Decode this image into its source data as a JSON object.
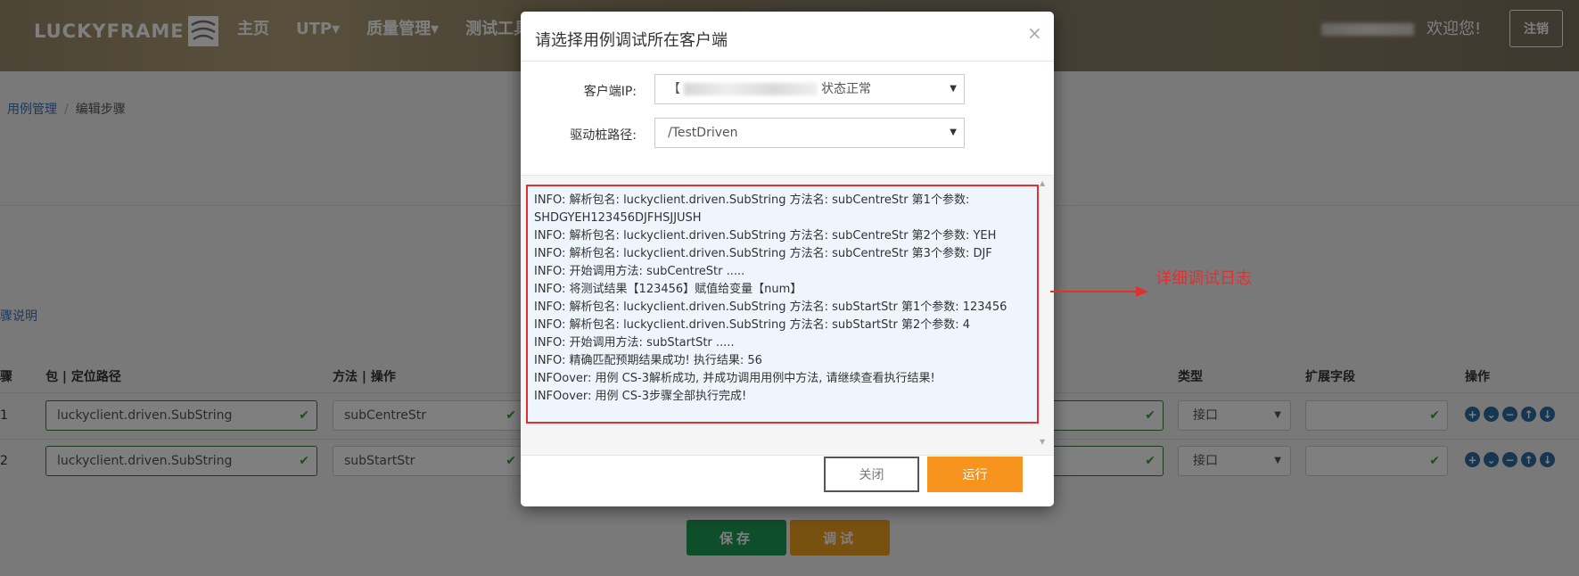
{
  "header": {
    "logo_text": "LUCKYFRAME",
    "nav": [
      "主页",
      "UTP▾",
      "质量管理▾",
      "测试工具"
    ],
    "welcome": "欢迎您!",
    "logout": "注销"
  },
  "breadcrumb": {
    "link": "用例管理",
    "separator": "/",
    "current": "编辑步骤"
  },
  "page": {
    "step_desc_link": "步骤说明",
    "columns": {
      "step": "步骤",
      "package": "包 | 定位路径",
      "method": "方法 | 操作",
      "type": "类型",
      "ext": "扩展字段",
      "ops": "操作"
    },
    "rows": [
      {
        "num": "1",
        "package": "luckyclient.driven.SubString",
        "method": "subCentreStr",
        "type": "接口"
      },
      {
        "num": "2",
        "package": "luckyclient.driven.SubString",
        "method": "subStartStr",
        "type": "接口"
      }
    ],
    "save": "保存",
    "debug": "调试"
  },
  "modal": {
    "title": "请选择用例调试所在客户端",
    "close_x": "×",
    "client_ip_label": "客户端IP:",
    "client_ip_prefix": "【",
    "client_ip_status": "状态正常",
    "driver_path_label": "驱动桩路径:",
    "driver_path_value": "/TestDriven",
    "log_lines": [
      "INFO: 解析包名: luckyclient.driven.SubString 方法名: subCentreStr 第1个参数:",
      "SHDGYEH123456DJFHSJJUSH",
      "INFO: 解析包名: luckyclient.driven.SubString 方法名: subCentreStr 第2个参数: YEH",
      "INFO: 解析包名: luckyclient.driven.SubString 方法名: subCentreStr 第3个参数: DJF",
      "INFO: 开始调用方法: subCentreStr .....",
      "INFO: 将测试结果【123456】赋值给变量【num】",
      "INFO: 解析包名: luckyclient.driven.SubString 方法名: subStartStr 第1个参数: 123456",
      "INFO: 解析包名: luckyclient.driven.SubString 方法名: subStartStr 第2个参数: 4",
      "INFO: 开始调用方法: subStartStr .....",
      "INFO: 精确匹配预期结果成功! 执行结果: 56",
      "INFOover: 用例 CS-3解析成功, 并成功调用用例中方法, 请继续查看执行结果!",
      "INFOover: 用例 CS-3步骤全部执行完成!"
    ],
    "close_button": "关闭",
    "run_button": "运行"
  },
  "annotation": {
    "text": "详细调试日志",
    "color": "#e03131"
  },
  "colors": {
    "run": "#f7941d",
    "save": "#1f9d55",
    "debug": "#f0a020",
    "link": "#3b73b9"
  }
}
